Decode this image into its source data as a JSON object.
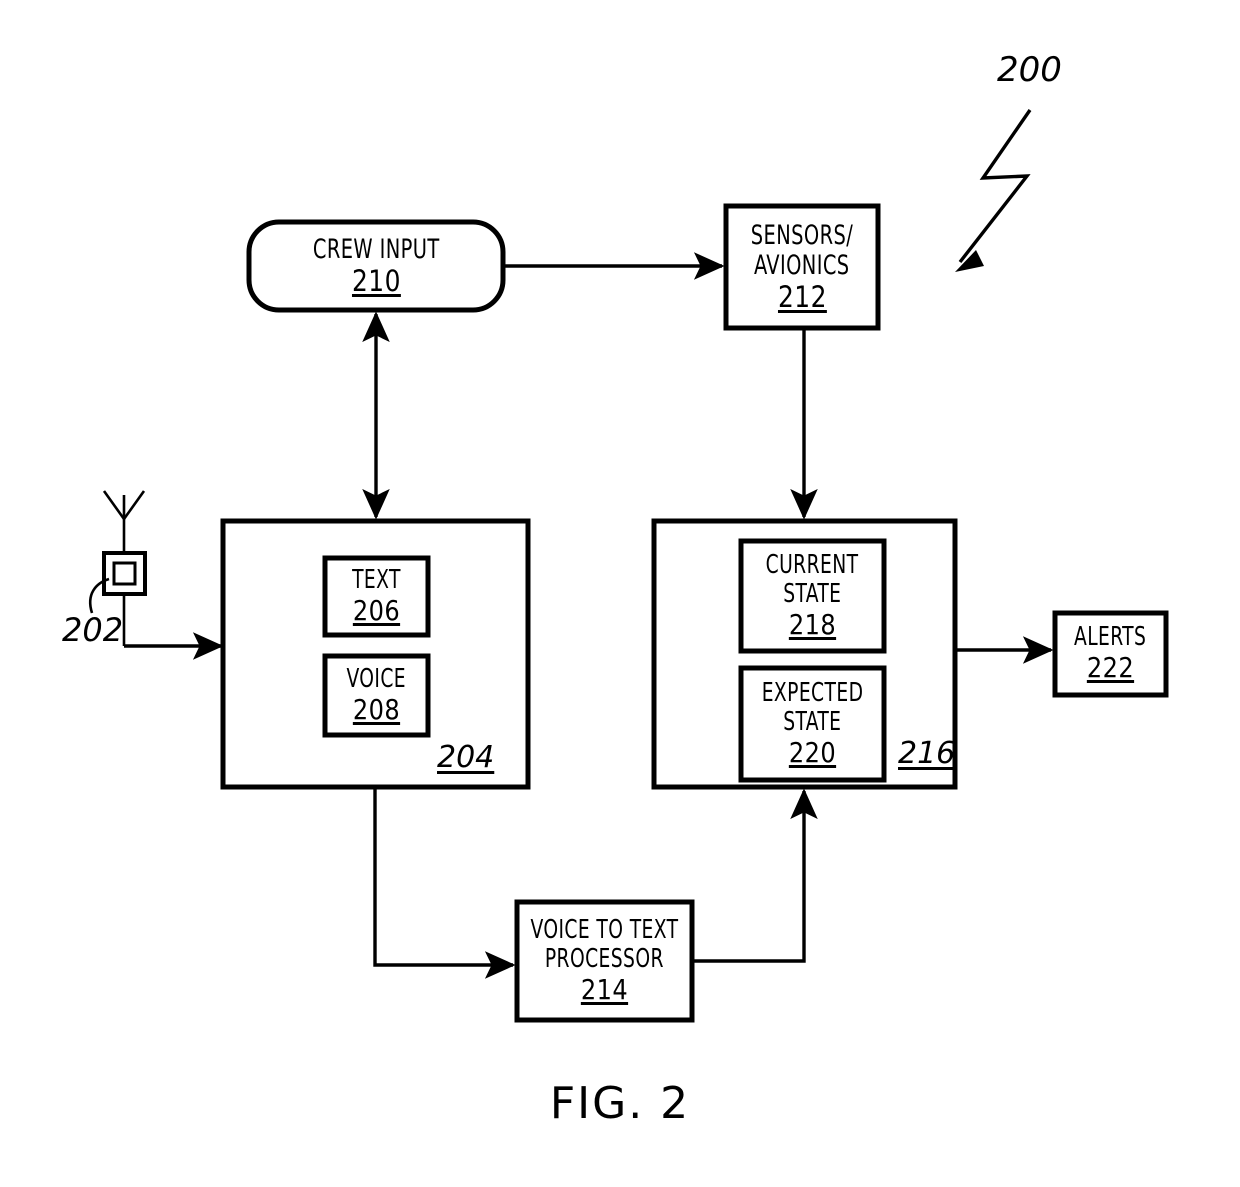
{
  "figure": {
    "caption": "FIG. 2",
    "overall_ref": "200"
  },
  "nodes": {
    "antenna": {
      "name": "antenna",
      "ref": "202"
    },
    "crew_input": {
      "lines": [
        "CREW INPUT"
      ],
      "ref": "210",
      "shape": "rounded-rect"
    },
    "sensors_avionics": {
      "lines": [
        "SENSORS/",
        "AVIONICS"
      ],
      "ref": "212",
      "shape": "rect"
    },
    "comm_unit": {
      "ref": "204",
      "shape": "rect",
      "children": {
        "text": {
          "lines": [
            "TEXT"
          ],
          "ref": "206"
        },
        "voice": {
          "lines": [
            "VOICE"
          ],
          "ref": "208"
        }
      }
    },
    "state_unit": {
      "ref": "216",
      "shape": "rect",
      "children": {
        "current_state": {
          "lines": [
            "CURRENT",
            "STATE"
          ],
          "ref": "218"
        },
        "expected_state": {
          "lines": [
            "EXPECTED",
            "STATE"
          ],
          "ref": "220"
        }
      }
    },
    "alerts": {
      "lines": [
        "ALERTS"
      ],
      "ref": "222",
      "shape": "rect"
    },
    "voice_to_text": {
      "lines": [
        "VOICE TO TEXT",
        "PROCESSOR"
      ],
      "ref": "214",
      "shape": "rect"
    }
  },
  "connections": [
    {
      "id": "antenna-to-comm",
      "from": "antenna",
      "to": "comm_unit",
      "arrow": "single"
    },
    {
      "id": "crew-to-sensors",
      "from": "crew_input",
      "to": "sensors_avionics",
      "arrow": "single"
    },
    {
      "id": "crew-comm-bidirectional",
      "from": "crew_input",
      "to": "comm_unit",
      "arrow": "double"
    },
    {
      "id": "sensors-to-state",
      "from": "sensors_avionics",
      "to": "state_unit",
      "arrow": "single"
    },
    {
      "id": "state-to-alerts",
      "from": "state_unit",
      "to": "alerts",
      "arrow": "single"
    },
    {
      "id": "comm-to-v2t",
      "from": "comm_unit",
      "to": "voice_to_text",
      "arrow": "single"
    },
    {
      "id": "v2t-to-state",
      "from": "voice_to_text",
      "to": "state_unit",
      "arrow": "single"
    }
  ],
  "style": {
    "stroke": "#000000",
    "fill": "#ffffff"
  }
}
